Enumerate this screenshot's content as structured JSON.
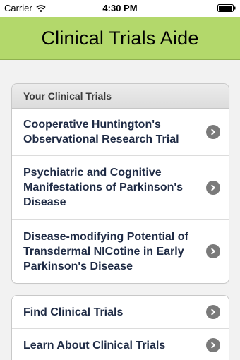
{
  "status_bar": {
    "carrier": "Carrier",
    "time": "4:30 PM",
    "icons": [
      "wifi-icon",
      "battery-icon"
    ]
  },
  "header": {
    "title": "Clinical Trials Aide",
    "background_color": "#b3d86b"
  },
  "your_trials": {
    "header": "Your Clinical Trials",
    "items": [
      {
        "label": "Cooperative Huntington's Observational Research Trial"
      },
      {
        "label": "Psychiatric and Cognitive Manifestations of Parkinson's Disease"
      },
      {
        "label": "Disease-modifying Potential of Transdermal NICotine in Early Parkinson's Disease"
      }
    ]
  },
  "links": {
    "items": [
      {
        "label": "Find Clinical Trials"
      },
      {
        "label": "Learn About Clinical Trials"
      }
    ]
  },
  "colors": {
    "row_text": "#1f2b45",
    "chevron_bg": "#7a7a7a"
  }
}
